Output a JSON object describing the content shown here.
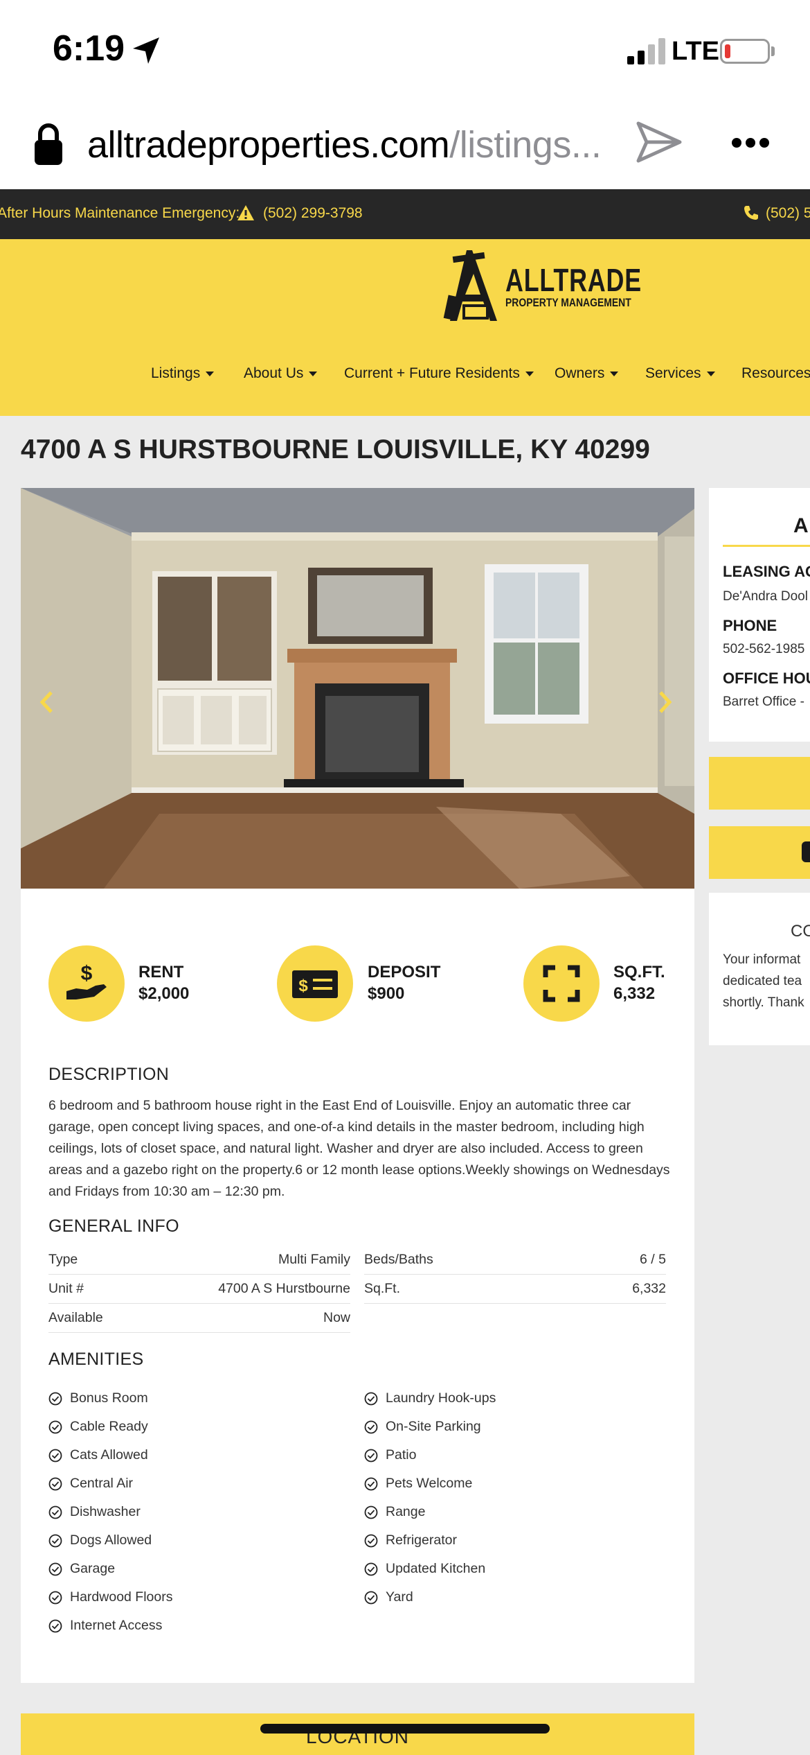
{
  "status_bar": {
    "time": "6:19",
    "network": "LTE",
    "battery_color": "#e53935"
  },
  "browser": {
    "url_host": "alltradeproperties.com",
    "url_path": "/listings..."
  },
  "emergency_bar": {
    "label": "After Hours Maintenance Emergency:",
    "phone": "(502) 299-3798",
    "phone2": "(502) 5"
  },
  "logo": {
    "title": "ALLTRADE",
    "subtitle": "PROPERTY MANAGEMENT"
  },
  "nav": [
    "Listings",
    "About Us",
    "Current + Future Residents",
    "Owners",
    "Services",
    "Resources"
  ],
  "property": {
    "title": "4700 A S HURSTBOURNE LOUISVILLE, KY 40299",
    "stats": [
      {
        "label": "RENT",
        "value": "$2,000",
        "icon": "hand-dollar-icon"
      },
      {
        "label": "DEPOSIT",
        "value": "$900",
        "icon": "dollar-bill-icon"
      },
      {
        "label": "SQ.FT.",
        "value": "6,332",
        "icon": "expand-icon"
      }
    ],
    "description_heading": "DESCRIPTION",
    "description": "6 bedroom and 5 bathroom house right in the East End of Louisville. Enjoy an automatic three car garage, open concept living spaces, and one-of-a kind details in the master bedroom, including high ceilings, lots of closet space, and natural light. Washer and dryer are also included. Access to green areas and a gazebo right on the property.6 or 12 month lease options.Weekly showings on Wednesdays and Fridays from 10:30 am – 12:30 pm.",
    "general_heading": "GENERAL INFO",
    "general_left": [
      {
        "k": "Type",
        "v": "Multi Family"
      },
      {
        "k": "Unit #",
        "v": "4700 A S Hurstbourne"
      },
      {
        "k": "Available",
        "v": "Now"
      }
    ],
    "general_right": [
      {
        "k": "Beds/Baths",
        "v": "6 / 5"
      },
      {
        "k": "Sq.Ft.",
        "v": "6,332"
      }
    ],
    "amenities_heading": "AMENITIES",
    "amenities_left": [
      "Bonus Room",
      "Cable Ready",
      "Cats Allowed",
      "Central Air",
      "Dishwasher",
      "Dogs Allowed",
      "Garage",
      "Hardwood Floors",
      "Internet Access"
    ],
    "amenities_right": [
      "Laundry Hook-ups",
      "On-Site Parking",
      "Patio",
      "Pets Welcome",
      "Range",
      "Refrigerator",
      "Updated Kitchen",
      "Yard"
    ]
  },
  "sidebar": {
    "heading": "A",
    "leasing_label": "LEASING AG",
    "leasing_name": "De'Andra Dool",
    "phone_label": "PHONE",
    "phone": "502-562-1985",
    "hours_label": "OFFICE HOU",
    "hours": "Barret Office -",
    "contact_heading": "CO",
    "contact_lines": [
      "Your informat",
      "dedicated tea",
      "shortly. Thank"
    ]
  },
  "location_heading": "LOCATION",
  "colors": {
    "brand_yellow": "#f8d84a",
    "dark_bar": "#272727"
  }
}
